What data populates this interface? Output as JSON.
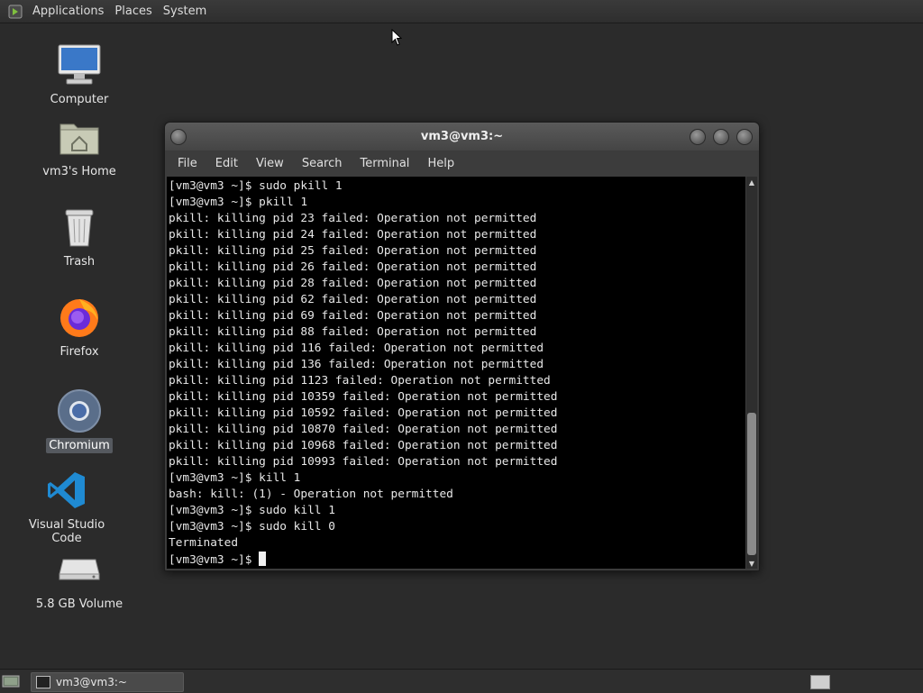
{
  "top_panel": {
    "menus": [
      "Applications",
      "Places",
      "System"
    ]
  },
  "desktop": {
    "icons": [
      {
        "label": "Computer",
        "icon": "computer-icon"
      },
      {
        "label": "vm3's Home",
        "icon": "home-folder-icon"
      },
      {
        "label": "Trash",
        "icon": "trash-icon"
      },
      {
        "label": "Firefox",
        "icon": "firefox-icon"
      },
      {
        "label": "Chromium",
        "icon": "chromium-icon",
        "selected": true
      },
      {
        "label": "Visual Studio Code",
        "icon": "vscode-icon"
      },
      {
        "label": "5.8 GB Volume",
        "icon": "drive-icon"
      }
    ]
  },
  "terminal": {
    "title": "vm3@vm3:~",
    "menus": [
      "File",
      "Edit",
      "View",
      "Search",
      "Terminal",
      "Help"
    ],
    "lines": [
      "[vm3@vm3 ~]$ sudo pkill 1",
      "[vm3@vm3 ~]$ pkill 1",
      "pkill: killing pid 23 failed: Operation not permitted",
      "pkill: killing pid 24 failed: Operation not permitted",
      "pkill: killing pid 25 failed: Operation not permitted",
      "pkill: killing pid 26 failed: Operation not permitted",
      "pkill: killing pid 28 failed: Operation not permitted",
      "pkill: killing pid 62 failed: Operation not permitted",
      "pkill: killing pid 69 failed: Operation not permitted",
      "pkill: killing pid 88 failed: Operation not permitted",
      "pkill: killing pid 116 failed: Operation not permitted",
      "pkill: killing pid 136 failed: Operation not permitted",
      "pkill: killing pid 1123 failed: Operation not permitted",
      "pkill: killing pid 10359 failed: Operation not permitted",
      "pkill: killing pid 10592 failed: Operation not permitted",
      "pkill: killing pid 10870 failed: Operation not permitted",
      "pkill: killing pid 10968 failed: Operation not permitted",
      "pkill: killing pid 10993 failed: Operation not permitted",
      "[vm3@vm3 ~]$ kill 1",
      "bash: kill: (1) - Operation not permitted",
      "[vm3@vm3 ~]$ sudo kill 1",
      "[vm3@vm3 ~]$ sudo kill 0",
      "Terminated"
    ],
    "prompt": "[vm3@vm3 ~]$ "
  },
  "bottom_panel": {
    "task_label": "vm3@vm3:~"
  }
}
